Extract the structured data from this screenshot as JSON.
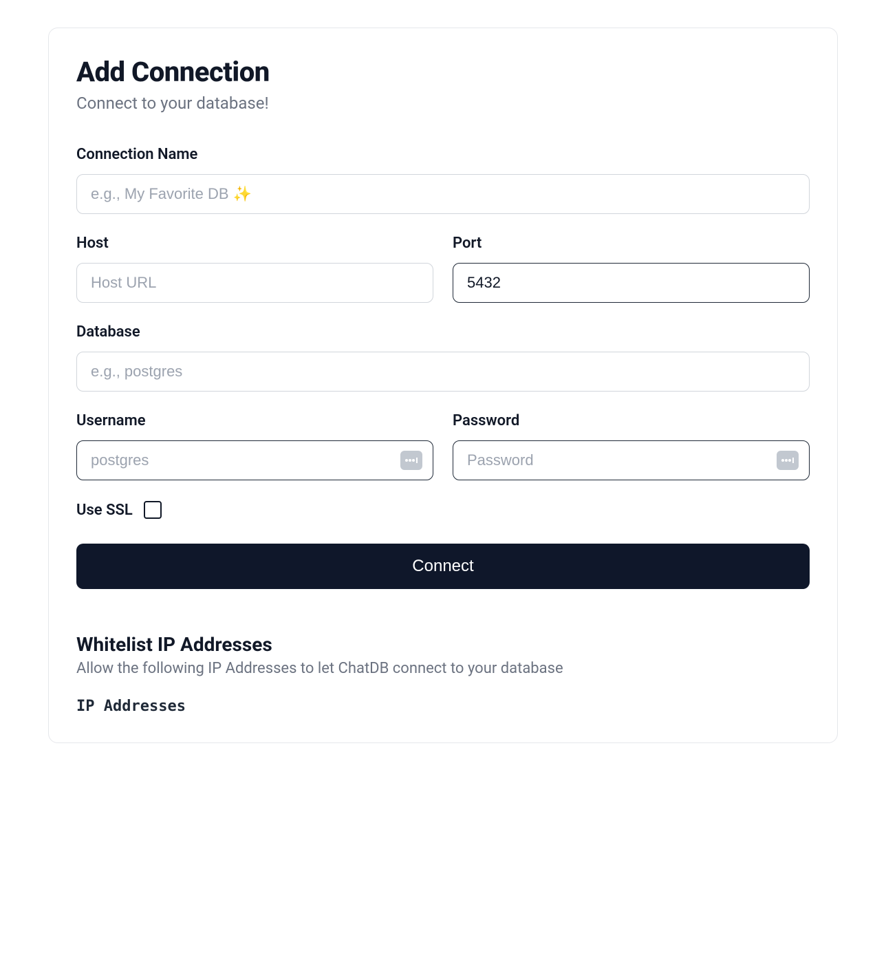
{
  "header": {
    "title": "Add Connection",
    "subtitle": "Connect to your database!"
  },
  "fields": {
    "connection_name": {
      "label": "Connection Name",
      "placeholder": "e.g., My Favorite DB ✨",
      "value": ""
    },
    "host": {
      "label": "Host",
      "placeholder": "Host URL",
      "value": ""
    },
    "port": {
      "label": "Port",
      "placeholder": "",
      "value": "5432"
    },
    "database": {
      "label": "Database",
      "placeholder": "e.g., postgres",
      "value": ""
    },
    "username": {
      "label": "Username",
      "placeholder": "postgres",
      "value": ""
    },
    "password": {
      "label": "Password",
      "placeholder": "Password",
      "value": ""
    },
    "use_ssl": {
      "label": "Use SSL",
      "checked": false
    }
  },
  "buttons": {
    "connect": "Connect"
  },
  "whitelist": {
    "title": "Whitelist IP Addresses",
    "subtitle": "Allow the following IP Addresses to let ChatDB connect to your database",
    "ip_label": "IP Addresses"
  }
}
